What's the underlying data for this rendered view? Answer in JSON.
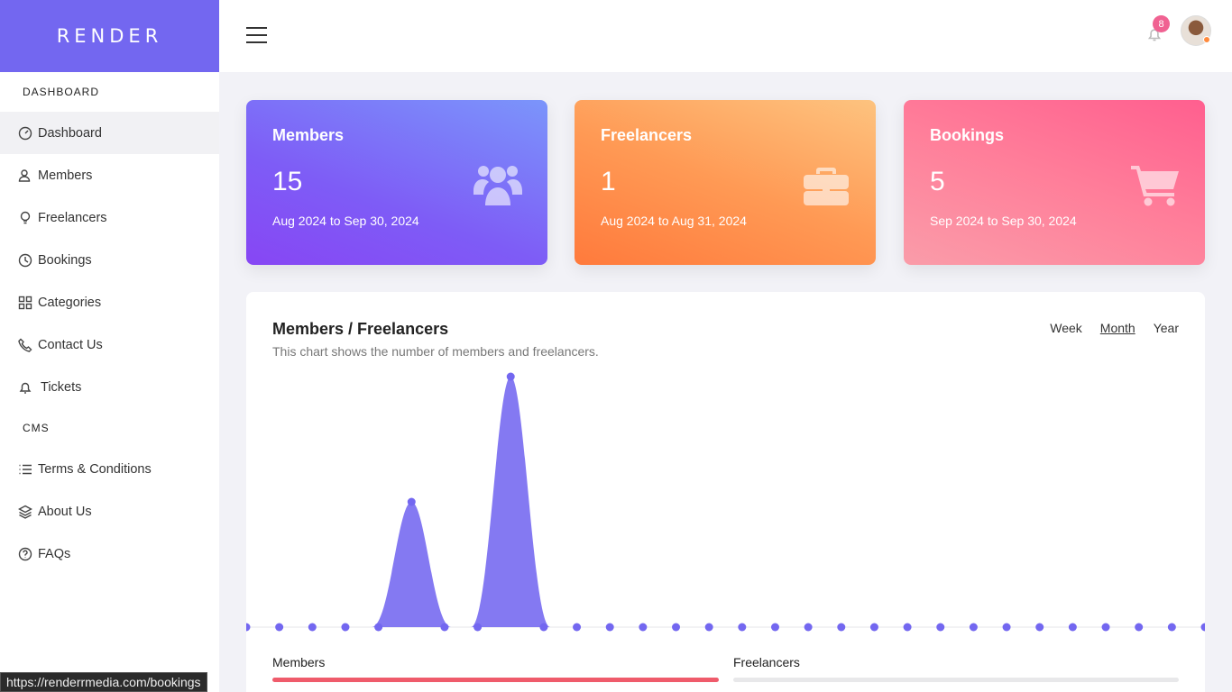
{
  "brand": "RENDER",
  "sidebar": {
    "section1": "DASHBOARD",
    "items": [
      {
        "label": "Dashboard",
        "icon": "speedometer-icon"
      },
      {
        "label": "Members",
        "icon": "user-icon"
      },
      {
        "label": "Freelancers",
        "icon": "lightbulb-icon"
      },
      {
        "label": "Bookings",
        "icon": "clock-icon"
      },
      {
        "label": "Categories",
        "icon": "grid-icon"
      },
      {
        "label": "Contact Us",
        "icon": "phone-icon"
      },
      {
        "label": "Tickets",
        "icon": "bell-icon"
      }
    ],
    "section2": "CMS",
    "cms_items": [
      {
        "label": "Terms & Conditions",
        "icon": "list-icon"
      },
      {
        "label": "About Us",
        "icon": "layers-icon"
      },
      {
        "label": "FAQs",
        "icon": "question-icon"
      }
    ]
  },
  "topbar": {
    "notification_count": "8"
  },
  "cards": [
    {
      "title": "Members",
      "value": "15",
      "range": "Aug 2024 to Sep 30, 2024",
      "icon": "users-icon"
    },
    {
      "title": "Freelancers",
      "value": "1",
      "range": "Aug 2024 to Aug 31, 2024",
      "icon": "briefcase-icon"
    },
    {
      "title": "Bookings",
      "value": "5",
      "range": "Sep 2024 to Sep 30, 2024",
      "icon": "cart-icon"
    }
  ],
  "chart_panel": {
    "title": "Members / Freelancers",
    "subtitle": "This chart shows the number of members and freelancers.",
    "tabs": [
      "Week",
      "Month",
      "Year"
    ],
    "active_tab": "Month",
    "legend": [
      "Members",
      "Freelancers"
    ]
  },
  "chart_data": {
    "type": "area",
    "series": [
      {
        "name": "Members",
        "values": [
          0,
          0,
          0,
          0,
          0,
          5,
          0,
          0,
          10,
          0,
          0,
          0,
          0,
          0,
          0,
          0,
          0,
          0,
          0,
          0,
          0,
          0,
          0,
          0,
          0,
          0,
          0,
          0,
          0,
          0
        ],
        "color": "#7367f0"
      }
    ],
    "grid": false
  },
  "colors": {
    "accent": "#7367f0",
    "members_bar": "#ef5b6b",
    "freelancers_bar": "#e8e8ea"
  },
  "status_url": "https://renderrmedia.com/bookings"
}
